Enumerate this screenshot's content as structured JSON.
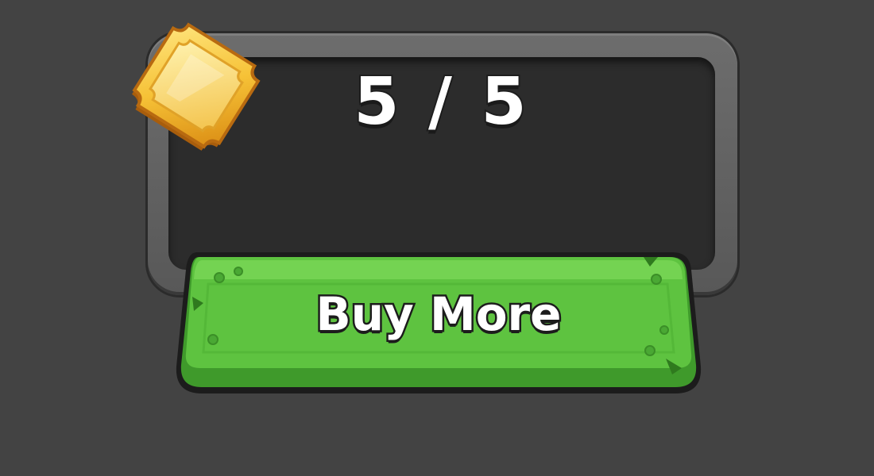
{
  "counter": {
    "current": "5",
    "max": "5",
    "text": "5 / 5"
  },
  "ticket_icon": "golden-ticket-icon",
  "button": {
    "label": "Buy More"
  },
  "colors": {
    "background": "#434343",
    "panel_frame": "#626262",
    "panel_inner": "#2c2c2c",
    "button_green": "#5cbf3e",
    "button_green_dark": "#3e9a2a",
    "ticket_gold": "#f0b429"
  }
}
